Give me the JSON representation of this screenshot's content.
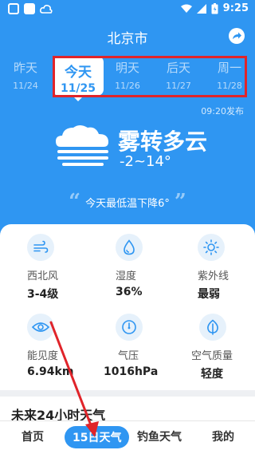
{
  "status": {
    "time": "9:25"
  },
  "header": {
    "city": "北京市"
  },
  "day_tabs": [
    {
      "name": "昨天",
      "date": "11/24"
    },
    {
      "name": "今天",
      "date": "11/25"
    },
    {
      "name": "明天",
      "date": "11/26"
    },
    {
      "name": "后天",
      "date": "11/27"
    },
    {
      "name": "周一",
      "date": "11/28"
    }
  ],
  "publish_time": "09:20发布",
  "current": {
    "condition": "雾转多云",
    "temp_range": "-2~14°"
  },
  "tip": "今天最低温下降6°",
  "details": [
    {
      "icon": "wind-icon",
      "label": "西北风",
      "value": "3-4级"
    },
    {
      "icon": "humidity-icon",
      "label": "湿度",
      "value": "36%"
    },
    {
      "icon": "sun-icon",
      "label": "紫外线",
      "value": "最弱"
    },
    {
      "icon": "eye-icon",
      "label": "能见度",
      "value": "6.94km"
    },
    {
      "icon": "pressure-icon",
      "label": "气压",
      "value": "1016hPa"
    },
    {
      "icon": "leaf-icon",
      "label": "空气质量",
      "value": "轻度"
    }
  ],
  "hourly": {
    "title": "未来24小时天气"
  },
  "nav": [
    {
      "label": "首页"
    },
    {
      "label": "15日天气"
    },
    {
      "label": "钓鱼天气"
    },
    {
      "label": "我的"
    }
  ],
  "colors": {
    "primary": "#2f96f2",
    "highlight": "#e0242a",
    "annotation_arrow": "#e0242a"
  }
}
